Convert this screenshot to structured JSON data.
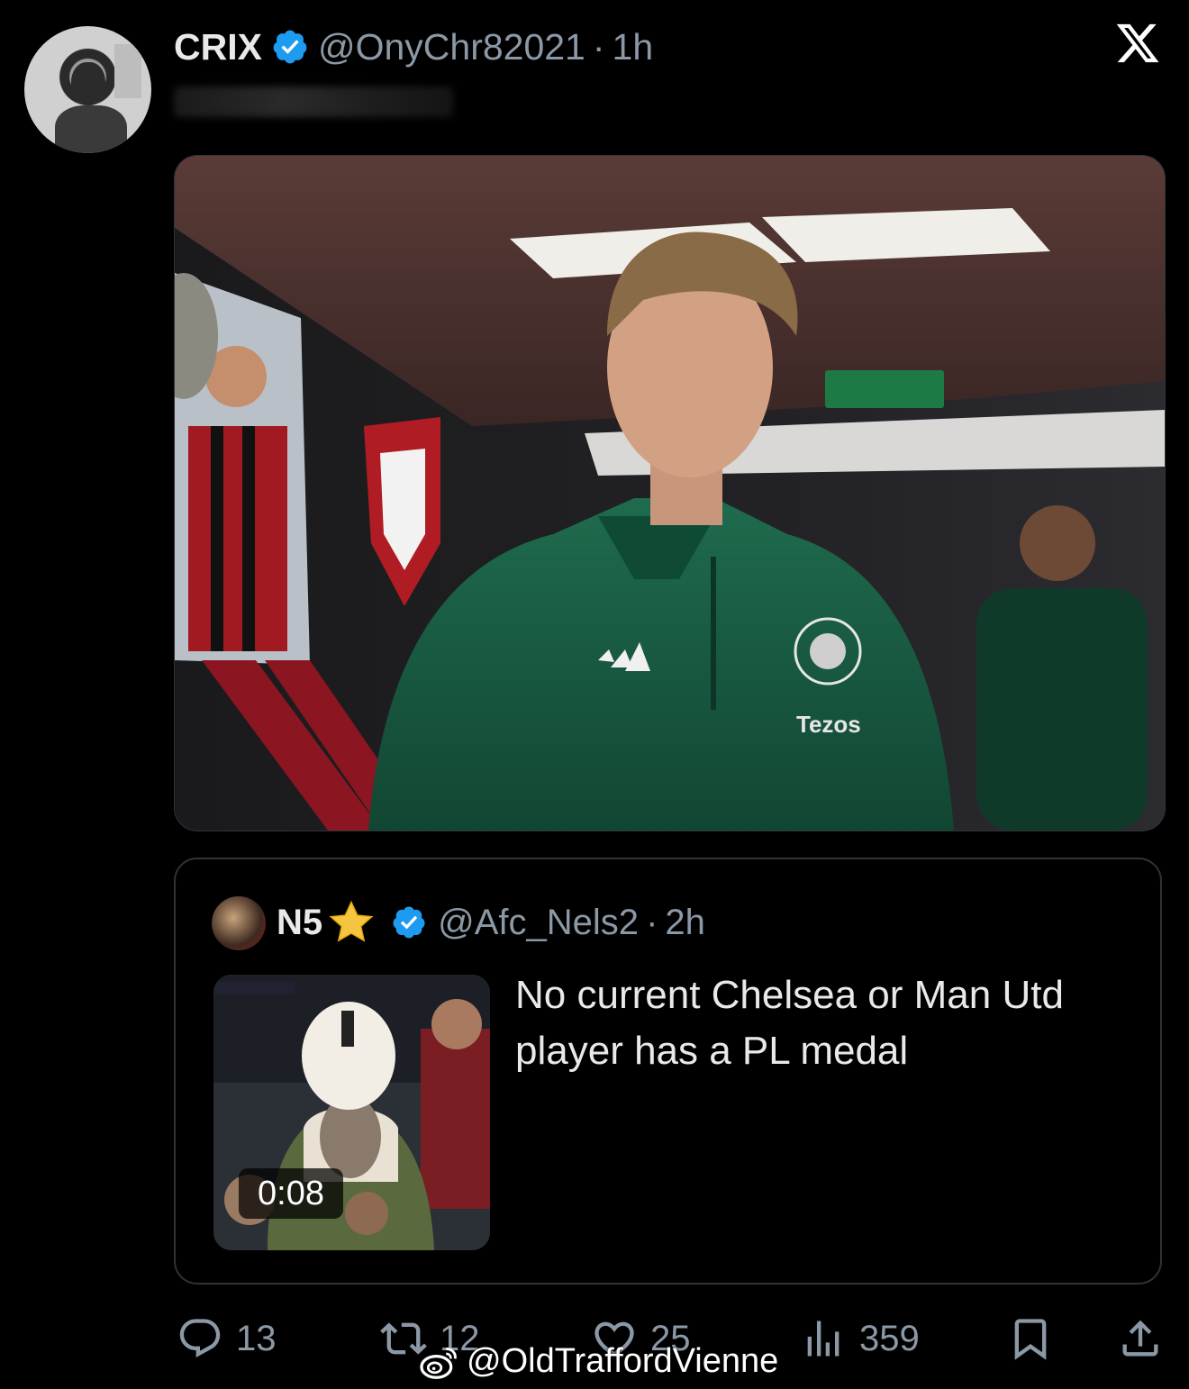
{
  "tweet": {
    "author_name": "CRIX",
    "handle": "@OnyChr82021",
    "separator": "·",
    "time": "1h",
    "verified_icon": "verified-badge-icon",
    "photo_sponsor_text": "Tezos"
  },
  "quoted": {
    "author_name": "N5",
    "name_emoji_icon": "star-icon",
    "handle": "@Afc_Nels2",
    "separator": "·",
    "time": "2h",
    "text": "No current Chelsea or Man Utd player has a PL medal",
    "video_duration": "0:08"
  },
  "actions": {
    "replies": "13",
    "reposts": "12",
    "likes": "25",
    "views": "359"
  },
  "watermark": "@OldTraffordVienne",
  "colors": {
    "background": "#000000",
    "text": "#e7e9ea",
    "muted": "#8b98a5",
    "verified": "#1d9bf0",
    "border": "#2f3336"
  }
}
